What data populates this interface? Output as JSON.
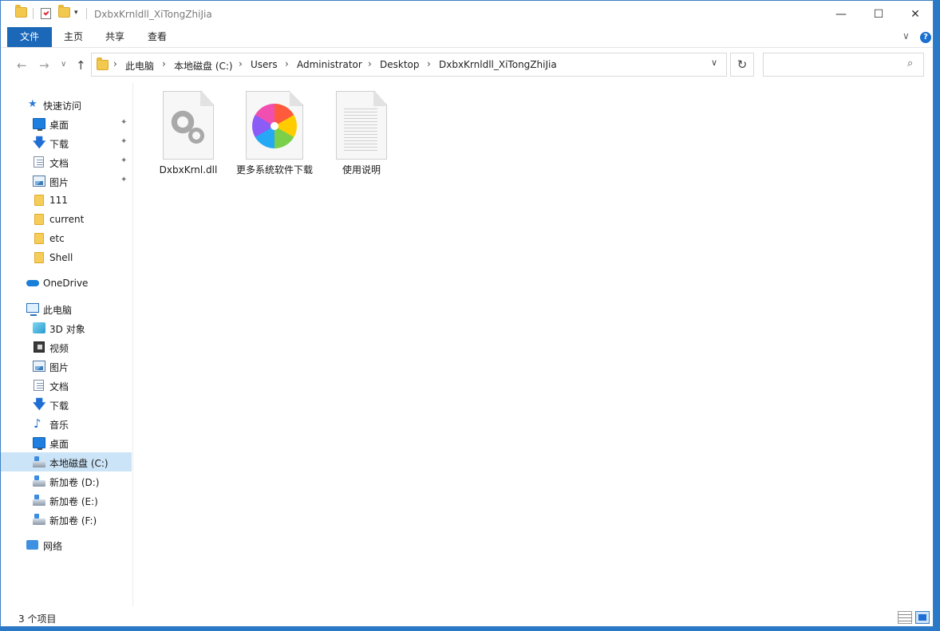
{
  "window": {
    "title": "DxbxKrnldll_XiTongZhiJia",
    "controls": {
      "minimize": "—",
      "maximize": "☐",
      "close": "✕"
    }
  },
  "ribbon": {
    "tabs": [
      "文件",
      "主页",
      "共享",
      "查看"
    ],
    "help": "?",
    "collapse": "∨"
  },
  "nav": {
    "back": "←",
    "forward": "→",
    "recent": "∨",
    "up": "↑",
    "breadcrumbs": [
      "此电脑",
      "本地磁盘 (C:)",
      "Users",
      "Administrator",
      "Desktop",
      "DxbxKrnldll_XiTongZhiJia"
    ],
    "separator": "›",
    "dropdown": "∨",
    "refresh": "↻",
    "search_placeholder": "",
    "search_icon": "⌕"
  },
  "sidebar": {
    "quick_access": "快速访问",
    "quick_items": [
      {
        "label": "桌面",
        "icon": "desktop-icon",
        "pinned": true
      },
      {
        "label": "下载",
        "icon": "download-icon",
        "pinned": true
      },
      {
        "label": "文档",
        "icon": "document-icon",
        "pinned": true
      },
      {
        "label": "图片",
        "icon": "picture-icon",
        "pinned": true
      },
      {
        "label": "111",
        "icon": "folder-icon",
        "pinned": false
      },
      {
        "label": "current",
        "icon": "folder-icon",
        "pinned": false
      },
      {
        "label": "etc",
        "icon": "folder-icon",
        "pinned": false
      },
      {
        "label": "Shell",
        "icon": "folder-icon",
        "pinned": false
      }
    ],
    "onedrive": "OneDrive",
    "this_pc": "此电脑",
    "pc_items": [
      {
        "label": "3D 对象",
        "icon": "3d-objects-icon"
      },
      {
        "label": "视频",
        "icon": "video-icon"
      },
      {
        "label": "图片",
        "icon": "picture-icon"
      },
      {
        "label": "文档",
        "icon": "document-icon"
      },
      {
        "label": "下载",
        "icon": "download-icon"
      },
      {
        "label": "音乐",
        "icon": "music-icon"
      },
      {
        "label": "桌面",
        "icon": "desktop-icon"
      },
      {
        "label": "本地磁盘 (C:)",
        "icon": "drive-icon",
        "selected": true
      },
      {
        "label": "新加卷 (D:)",
        "icon": "drive-icon"
      },
      {
        "label": "新加卷 (E:)",
        "icon": "drive-icon"
      },
      {
        "label": "新加卷 (F:)",
        "icon": "drive-icon"
      }
    ],
    "network": "网络",
    "pin_glyph": "📌"
  },
  "files": [
    {
      "name": "DxbxKrnl.dll",
      "icon": "dll-file-icon"
    },
    {
      "name": "更多系统软件下载",
      "icon": "browser-shortcut-icon"
    },
    {
      "name": "使用说明",
      "icon": "text-file-icon"
    }
  ],
  "status": {
    "count": "3 个项目"
  }
}
